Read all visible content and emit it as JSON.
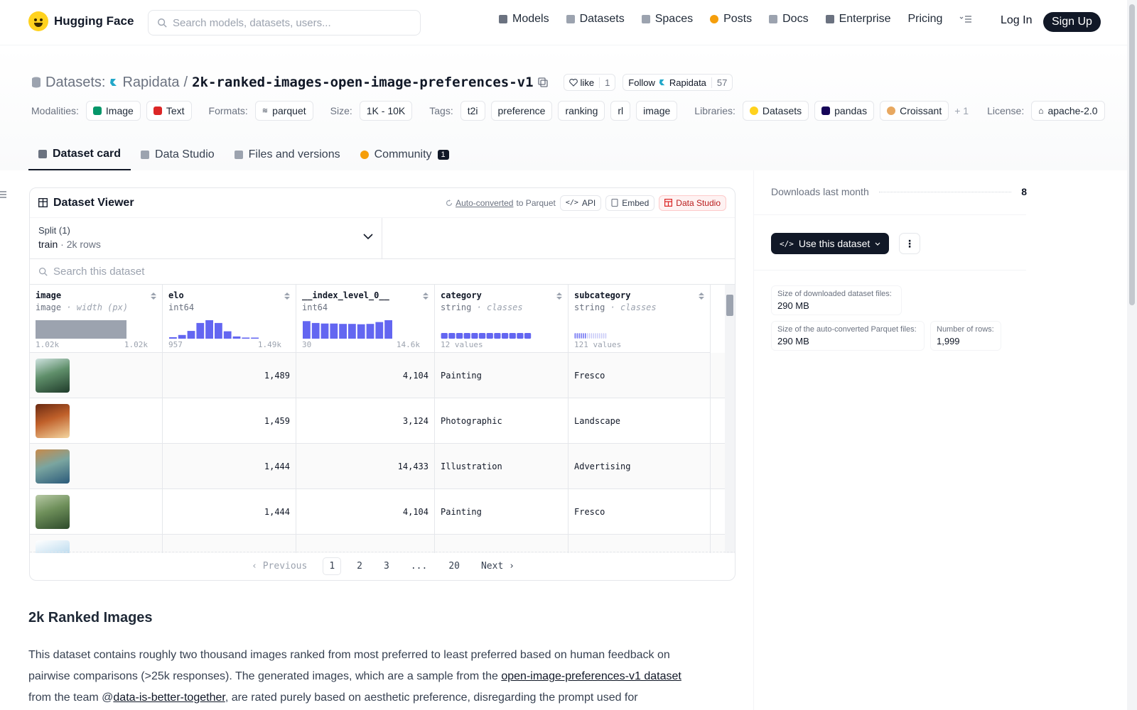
{
  "header": {
    "brand": "Hugging Face",
    "search_placeholder": "Search models, datasets, users...",
    "nav": [
      {
        "label": "Models",
        "icon": "cube-icon",
        "color": "#6b7280"
      },
      {
        "label": "Datasets",
        "icon": "database-icon",
        "color": "#9ca3af"
      },
      {
        "label": "Spaces",
        "icon": "grid-icon",
        "color": "#9ca3af"
      },
      {
        "label": "Posts",
        "icon": "posts-icon",
        "color": "#f59e0b"
      },
      {
        "label": "Docs",
        "icon": "book-icon",
        "color": "#9ca3af"
      },
      {
        "label": "Enterprise",
        "icon": "enterprise-icon",
        "color": "#6b7280"
      },
      {
        "label": "Pricing",
        "icon": "",
        "color": ""
      }
    ],
    "login": "Log In",
    "signup": "Sign Up"
  },
  "repo": {
    "section": "Datasets:",
    "owner": "Rapidata",
    "separator": "/",
    "name": "2k-ranked-images-open-image-preferences-v1",
    "like_label": "like",
    "like_count": "1",
    "follow_label": "Follow",
    "follow_name": "Rapidata",
    "follow_count": "57"
  },
  "tags": {
    "modalities_label": "Modalities:",
    "modalities": [
      "Image",
      "Text"
    ],
    "formats_label": "Formats:",
    "formats": [
      "parquet"
    ],
    "size_label": "Size:",
    "size": [
      "1K - 10K"
    ],
    "tags_label": "Tags:",
    "tags": [
      "t2i",
      "preference",
      "ranking",
      "rl",
      "image"
    ],
    "libraries_label": "Libraries:",
    "libraries": [
      "Datasets",
      "pandas",
      "Croissant"
    ],
    "libraries_more": "+ 1",
    "license_label": "License:",
    "license": [
      "apache-2.0"
    ]
  },
  "tabs": [
    {
      "label": "Dataset card",
      "icon": "cube-icon",
      "active": true
    },
    {
      "label": "Data Studio",
      "icon": "table-icon",
      "active": false
    },
    {
      "label": "Files and versions",
      "icon": "files-icon",
      "active": false
    },
    {
      "label": "Community",
      "icon": "community-icon",
      "active": false,
      "badge": "1"
    }
  ],
  "viewer": {
    "title": "Dataset Viewer",
    "auto_converted": "Auto-converted",
    "to_parquet": "to Parquet",
    "api": "API",
    "embed": "Embed",
    "data_studio": "Data Studio",
    "split_label": "Split (1)",
    "split_name": "train",
    "split_dot": "·",
    "split_rows": "2k rows",
    "search_placeholder": "Search this dataset",
    "columns": [
      {
        "name": "image",
        "type": "image",
        "extra": "· width (px)",
        "min": "1.02k",
        "max": "1.02k",
        "hist": [
          1
        ]
      },
      {
        "name": "elo",
        "type": "int64",
        "extra": "",
        "min": "957",
        "max": "1.49k",
        "hist": [
          0.08,
          0.2,
          0.42,
          0.85,
          1.0,
          0.85,
          0.4,
          0.12,
          0.06,
          0.04
        ]
      },
      {
        "name": "__index_level_0__",
        "type": "int64",
        "extra": "",
        "min": "30",
        "max": "14.6k",
        "hist": [
          0.95,
          0.85,
          0.82,
          0.82,
          0.8,
          0.8,
          0.78,
          0.8,
          0.9,
          1.0
        ]
      },
      {
        "name": "category",
        "type": "string",
        "extra": "· classes",
        "min": "12 values",
        "max": "",
        "hist": []
      },
      {
        "name": "subcategory",
        "type": "string",
        "extra": "· classes",
        "min": "121 values",
        "max": "",
        "hist": []
      }
    ],
    "rows": [
      {
        "elo": "1,489",
        "index": "4,104",
        "category": "Painting",
        "subcategory": "Fresco",
        "thumb": [
          "#1f3b2a",
          "#5f8f6a",
          "#cfe3e0"
        ]
      },
      {
        "elo": "1,459",
        "index": "3,124",
        "category": "Photographic",
        "subcategory": "Landscape",
        "thumb": [
          "#f4d6a0",
          "#c0602a",
          "#6a2a12"
        ]
      },
      {
        "elo": "1,444",
        "index": "14,433",
        "category": "Illustration",
        "subcategory": "Advertising",
        "thumb": [
          "#2b5a7a",
          "#7aa5a0",
          "#c88a4a"
        ]
      },
      {
        "elo": "1,444",
        "index": "4,104",
        "category": "Painting",
        "subcategory": "Fresco",
        "thumb": [
          "#2d4a2a",
          "#6e8f5a",
          "#b7c9a5"
        ]
      },
      {
        "elo": "",
        "index": "",
        "category": "",
        "subcategory": "",
        "thumb": [
          "#7fb3d8",
          "#c9e2f2",
          "#ffffff"
        ]
      }
    ],
    "pager": {
      "prev": "Previous",
      "pages": [
        "1",
        "2",
        "3",
        "...",
        "20"
      ],
      "current": "1",
      "next": "Next"
    }
  },
  "sidebar": {
    "downloads_label": "Downloads last month",
    "downloads_value": "8",
    "use_dataset": "Use this dataset",
    "stats": [
      {
        "k": "Size of downloaded dataset files:",
        "v": "290 MB"
      },
      {
        "k": "Size of the auto-converted Parquet files:",
        "v": "290 MB"
      },
      {
        "k": "Number of rows:",
        "v": "1,999"
      }
    ]
  },
  "readme": {
    "heading": "2k Ranked Images",
    "p_part1": "This dataset contains roughly two thousand images ranked from most preferred to least preferred based on human feedback on pairwise comparisons (>25k responses). The generated images, which are a sample from the ",
    "link1": "open-image-preferences-v1 dataset",
    "p_part2": " from the team @",
    "link2": "data-is-better-together",
    "p_part3": ", are rated purely based on aesthetic preference, disregarding the prompt used for"
  },
  "colors": {
    "accent": "#6366f1",
    "dark": "#111827",
    "brand": "#ffd21e"
  }
}
